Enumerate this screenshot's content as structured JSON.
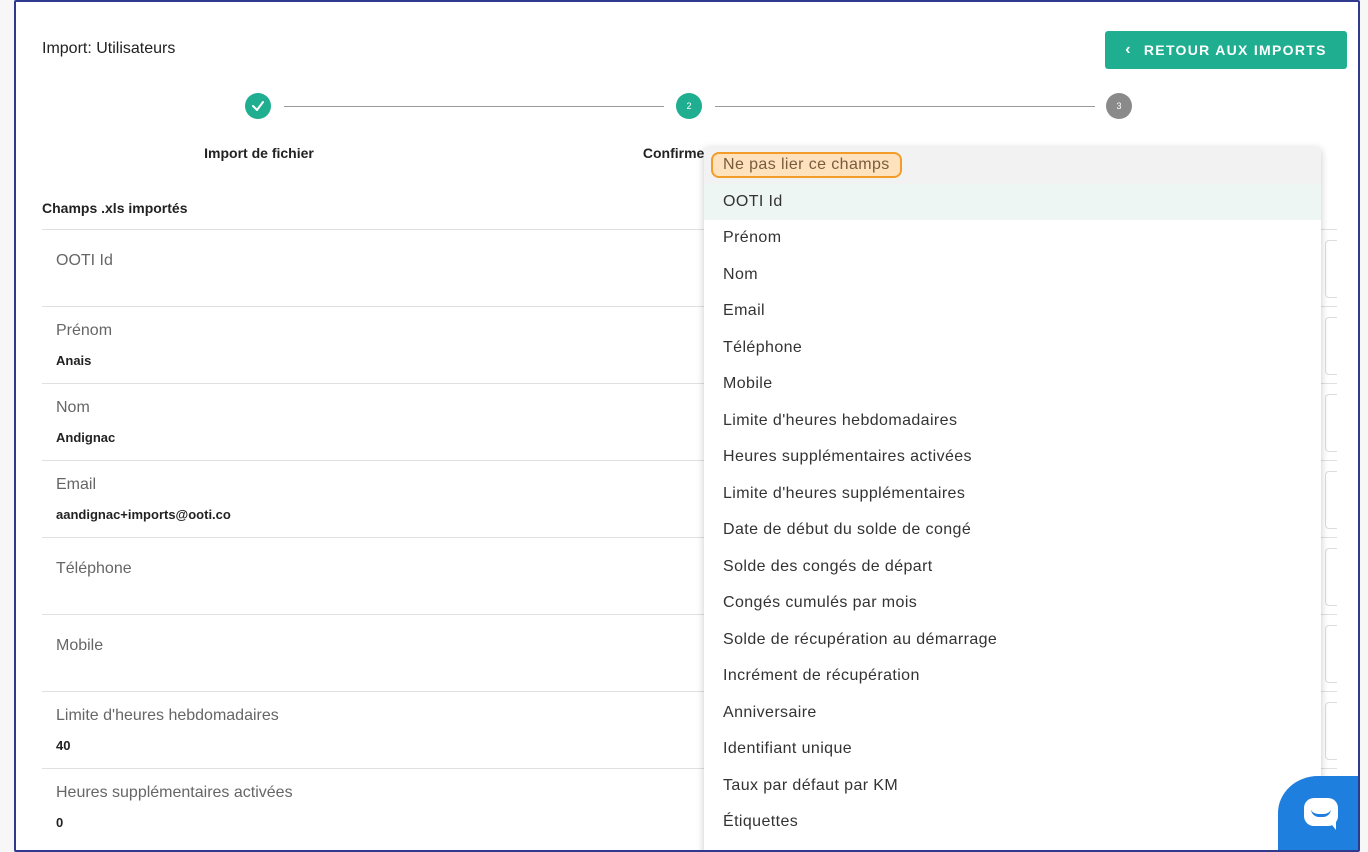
{
  "header": {
    "title": "Import: Utilisateurs",
    "back_button": "RETOUR AUX IMPORTS",
    "back_icon": "chevron-left-icon"
  },
  "stepper": {
    "steps": [
      {
        "number": "",
        "label": "Import de fichier",
        "state": "done",
        "color": "#1fae8f",
        "icon": "check-icon"
      },
      {
        "number": "2",
        "label": "Confirmer les",
        "state": "active",
        "color": "#1fae8f"
      },
      {
        "number": "3",
        "label": "",
        "state": "pending",
        "color": "#8a8a8a"
      }
    ]
  },
  "table": {
    "header": "Champs .xls importés",
    "rows": [
      {
        "label": "OOTI Id",
        "value": ""
      },
      {
        "label": "Prénom",
        "value": "Anais"
      },
      {
        "label": "Nom",
        "value": "Andignac"
      },
      {
        "label": "Email",
        "value": "aandignac+imports@ooti.co"
      },
      {
        "label": "Téléphone",
        "value": ""
      },
      {
        "label": "Mobile",
        "value": ""
      },
      {
        "label": "Limite d'heures hebdomadaires",
        "value": "40"
      },
      {
        "label": "Heures supplémentaires activées",
        "value": "0"
      }
    ]
  },
  "dropdown": {
    "options": [
      "Ne pas lier ce champs",
      "OOTI Id",
      "Prénom",
      "Nom",
      "Email",
      "Téléphone",
      "Mobile",
      "Limite d'heures hebdomadaires",
      "Heures supplémentaires activées",
      "Limite d'heures supplémentaires",
      "Date de début du solde de congé",
      "Solde des congés de départ",
      "Congés cumulés par mois",
      "Solde de récupération au démarrage",
      "Incrément de récupération",
      "Anniversaire",
      "Identifiant unique",
      "Taux par défaut par KM",
      "Étiquettes"
    ],
    "highlighted_color": "#f39c29"
  },
  "chat": {
    "icon": "chat-bubble-icon",
    "color": "#1e7fde"
  }
}
